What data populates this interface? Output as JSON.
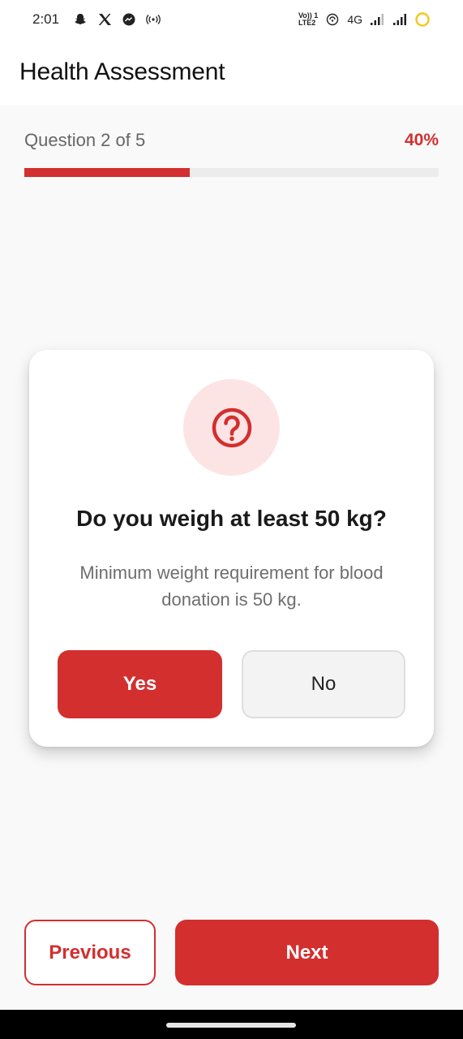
{
  "status_bar": {
    "time": "2:01",
    "left_icons": [
      "snapchat-icon",
      "x-icon",
      "messenger-icon",
      "hotspot-icon"
    ],
    "network_label_1": "Vo)) 1",
    "network_label_2": "LTE2",
    "network_type": "4G",
    "right_icons": [
      "wifi-calling-icon",
      "signal-icon",
      "signal-icon-2",
      "battery-icon"
    ]
  },
  "appbar": {
    "title": "Health Assessment"
  },
  "progress": {
    "label": "Question 2 of 5",
    "percent_label": "40%",
    "fraction": 0.4
  },
  "question": {
    "icon": "question-circle-icon",
    "title": "Do you weigh at least 50 kg?",
    "description": "Minimum weight requirement for blood donation is 50 kg.",
    "yes_label": "Yes",
    "no_label": "No",
    "selected": "Yes"
  },
  "footer": {
    "previous_label": "Previous",
    "next_label": "Next"
  },
  "colors": {
    "accent": "#d32f2f",
    "accent_light": "#fde4e4",
    "background": "#f9f9f9"
  }
}
